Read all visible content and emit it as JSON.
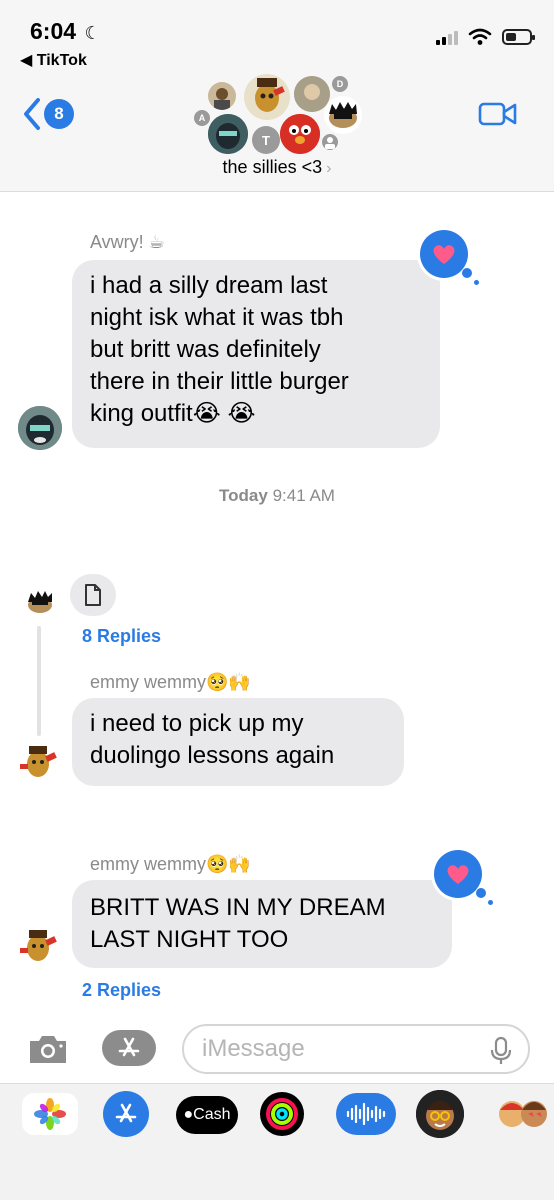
{
  "status_bar": {
    "time": "6:04",
    "back_app": "◀ TikTok"
  },
  "header": {
    "back_badge": "8",
    "group_name": "the sillies <3",
    "group_chevron": "›",
    "avatar_letters": [
      "A",
      "D",
      "T"
    ]
  },
  "messages": [
    {
      "sender": "Avwry! ☕",
      "lines": [
        "i had a silly dream last",
        "night isk what it was tbh",
        "but britt was definitely",
        "there in their little burger",
        "king outfit😭 😭"
      ],
      "tapback": "heart-icon"
    },
    {
      "type": "timestamp",
      "day": "Today",
      "time": "9:41 AM"
    },
    {
      "type": "attachment",
      "icon": "document-icon",
      "replies": "8 Replies"
    },
    {
      "sender": "emmy wemmy🥺🙌",
      "lines": [
        "i need to pick up my",
        "duolingo lessons again"
      ]
    },
    {
      "sender": "emmy wemmy🥺🙌",
      "lines": [
        "BRITT WAS IN MY DREAM",
        "LAST NIGHT TOO"
      ],
      "tapback": "heart-icon",
      "replies": "2 Replies"
    }
  ],
  "composer": {
    "placeholder": "iMessage"
  },
  "app_drawer": {
    "apps": [
      "photos-icon",
      "app-store-icon",
      "cash-icon",
      "activity-icon",
      "audio-message-icon",
      "memoji-icon",
      "memoji-stickers-icon"
    ],
    "cash_label": "Cash"
  },
  "colors": {
    "accent": "#2a7be4",
    "bubble": "#e9e9eb",
    "heart": "#ff5b8a"
  }
}
